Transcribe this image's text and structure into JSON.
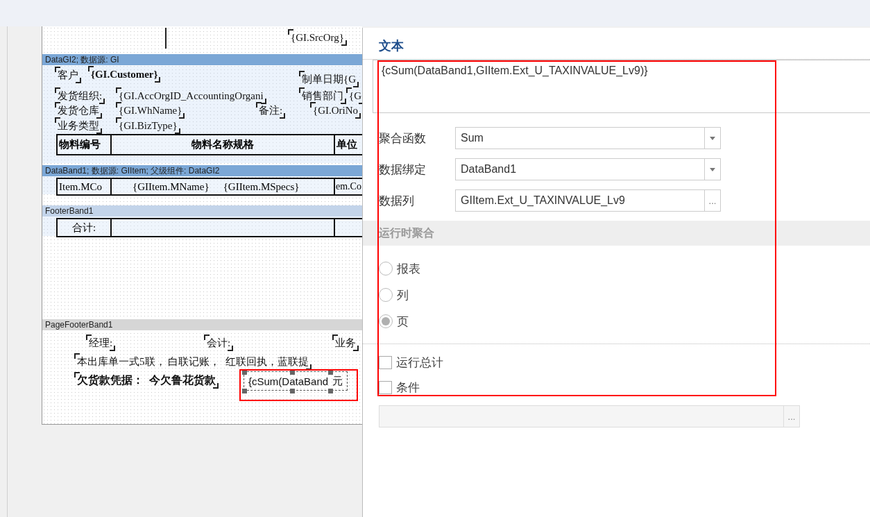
{
  "report": {
    "header_fields": [
      "{GI.SrcOrg}"
    ],
    "bands": [
      {
        "kind": "data",
        "title": "DataGI2; 数据源: GI"
      },
      {
        "kind": "data",
        "title": "DataBand1; 数据源: GIItem; 父级组件: DataGI2"
      },
      {
        "kind": "footer",
        "title": "FooterBand1"
      },
      {
        "kind": "page_footer",
        "title": "PageFooterBand1"
      }
    ],
    "group_fields": [
      "客户",
      "{GI.Customer}",
      "制单日期{G",
      "发货组织:",
      "{GI.AccOrgID_AccountingOrgani",
      "销售部门",
      "{G",
      "发货仓库",
      "{GI.WhName}",
      "备注:",
      "{GI.OriNo",
      "业务类型",
      "{GI.BizType}"
    ],
    "table_header": [
      "物料编号",
      "物料名称规格",
      "单位"
    ],
    "data_row": [
      "Item.MCo",
      "{GIItem.MName}",
      "{GIItem.MSpecs}",
      "em.Co"
    ],
    "footer_row": [
      "合计:"
    ],
    "page_footer_fields": [
      "经理:",
      "会计:",
      "业务",
      "本出库单一式5联， 白联记账，  红联回执，蓝联提",
      "欠货款凭据：  今欠鲁花货款"
    ],
    "selected_field": {
      "text": "{cSum(DataBand",
      "suffix": "元",
      "selected": true
    }
  },
  "dialog": {
    "title": "文本",
    "expression": "{cSum(DataBand1,GIItem.Ext_U_TAXINVALUE_Lv9)}",
    "fields": [
      {
        "label": "聚合函数",
        "value": "Sum",
        "kind": "select"
      },
      {
        "label": "数据绑定",
        "value": "DataBand1",
        "kind": "select"
      },
      {
        "label": "数据列",
        "value": "GIItem.Ext_U_TAXINVALUE_Lv9",
        "kind": "browse",
        "button": "..."
      }
    ],
    "section": "运行时聚合",
    "scopes": [
      {
        "label": "报表",
        "selected": false
      },
      {
        "label": "列",
        "selected": false
      },
      {
        "label": "页",
        "selected": true
      }
    ],
    "options": [
      {
        "label": "运行总计",
        "checked": false
      },
      {
        "label": "条件",
        "checked": false
      }
    ],
    "condition": {
      "disabled": true,
      "button": "..."
    }
  }
}
